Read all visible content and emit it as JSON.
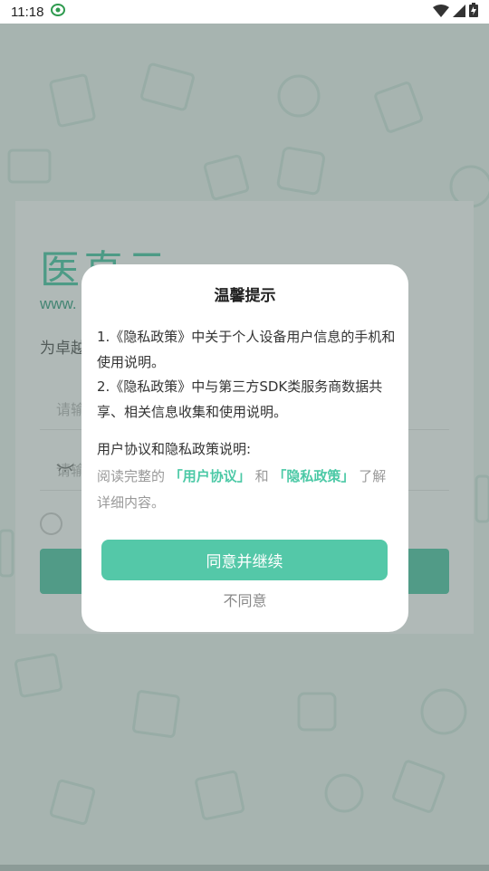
{
  "status_bar": {
    "time": "11:18"
  },
  "background": {
    "logo_text": "医直云",
    "logo_url": "www.",
    "tagline_prefix": "为卓越",
    "field1_placeholder": "请输",
    "field2_placeholder": "请输"
  },
  "dialog": {
    "title": "温馨提示",
    "line1": "1.《隐私政策》中关于个人设备用户信息的手机和使用说明。",
    "line2": "2.《隐私政策》中与第三方SDK类服务商数据共享、相关信息收集和使用说明。",
    "section_heading": "用户协议和隐私政策说明:",
    "section_prefix": "阅读完整的",
    "link_user_agreement": "「用户协议」",
    "section_and": "和",
    "link_privacy_policy": "「隐私政策」",
    "section_suffix": "了解详细内容。",
    "agree_label": "同意并继续",
    "disagree_label": "不同意"
  },
  "colors": {
    "accent": "#54c8a8",
    "link": "#4cc9a6",
    "overlay": "#50645f"
  }
}
